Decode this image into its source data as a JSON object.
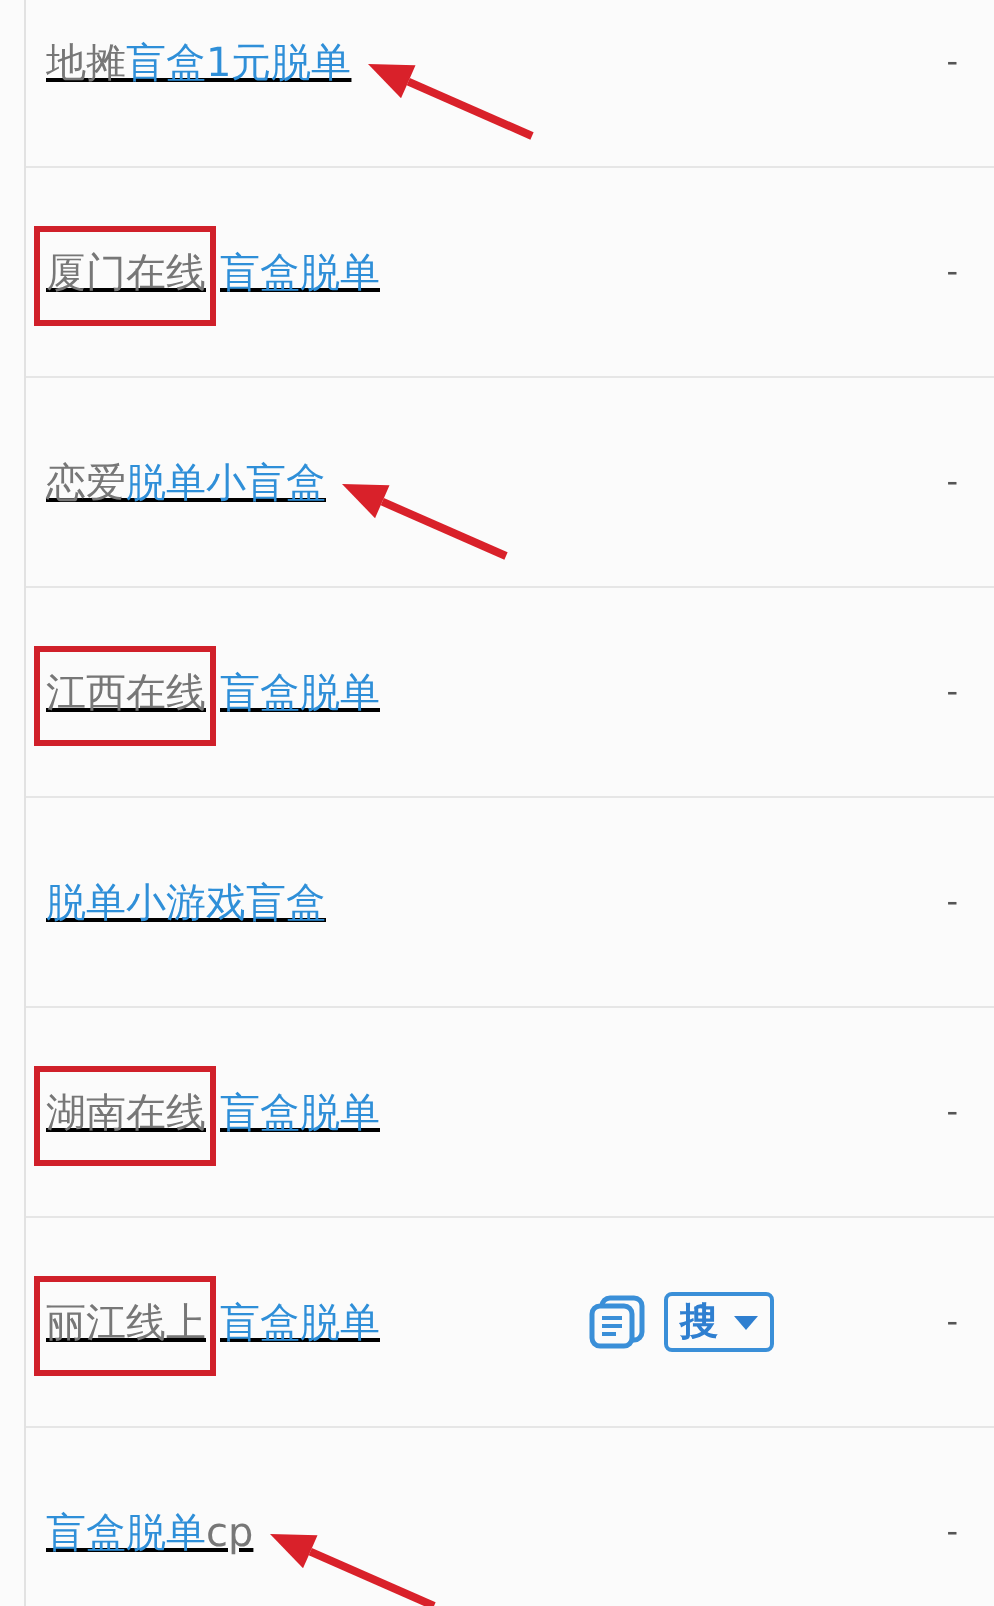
{
  "rows": [
    {
      "segments": [
        {
          "text": "地摊",
          "match": false
        },
        {
          "text": "盲盒1元脱单",
          "match": true
        }
      ],
      "value": "-",
      "highlight": false,
      "arrow": true
    },
    {
      "segments": [
        {
          "text": "厦门在线",
          "match": false
        },
        {
          "text": "盲盒脱单",
          "match": true
        }
      ],
      "value": "-",
      "highlight": true
    },
    {
      "segments": [
        {
          "text": "恋爱",
          "match": false
        },
        {
          "text": "脱单小盲盒",
          "match": true
        }
      ],
      "value": "-",
      "highlight": false,
      "arrow": true
    },
    {
      "segments": [
        {
          "text": "江西在线",
          "match": false
        },
        {
          "text": "盲盒脱单",
          "match": true
        }
      ],
      "value": "-",
      "highlight": true
    },
    {
      "segments": [
        {
          "text": "脱单小游戏盲盒",
          "match": true
        }
      ],
      "value": "-",
      "highlight": false
    },
    {
      "segments": [
        {
          "text": "湖南在线",
          "match": false
        },
        {
          "text": "盲盒脱单",
          "match": true
        }
      ],
      "value": "-",
      "highlight": true
    },
    {
      "segments": [
        {
          "text": "丽江线上",
          "match": false
        },
        {
          "text": "盲盒脱单",
          "match": true
        }
      ],
      "value": "-",
      "highlight": true,
      "tools": {
        "search_label": "搜"
      }
    },
    {
      "segments": [
        {
          "text": "盲盒脱单",
          "match": true
        },
        {
          "text": "cp",
          "match": false
        }
      ],
      "value": "-",
      "highlight": false,
      "arrow": true
    }
  ]
}
